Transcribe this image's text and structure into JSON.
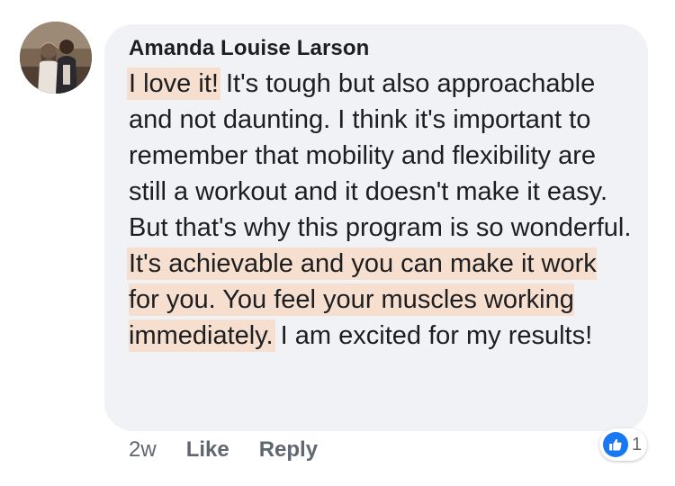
{
  "comment": {
    "author": "Amanda Louise Larson",
    "segments": [
      {
        "text": "I love it!",
        "highlight": true
      },
      {
        "text": " It's tough but also approachable and not daunting. I think it's important to remember that mobility and flexibility are still a workout and it doesn't make it easy. But that's why this program is so wonderful. ",
        "highlight": false
      },
      {
        "text": "It's achievable and you can make it work for you. You feel your muscles working immediately.",
        "highlight": true
      },
      {
        "text": " I am excited for my results!",
        "highlight": false
      }
    ],
    "highlight_color": "#f6dfcf"
  },
  "footer": {
    "timestamp": "2w",
    "like_label": "Like",
    "reply_label": "Reply"
  },
  "reactions": {
    "icon": "thumbs-up-icon",
    "count": "1",
    "color": "#1877f2"
  },
  "avatar": {
    "icon": "profile-photo"
  }
}
